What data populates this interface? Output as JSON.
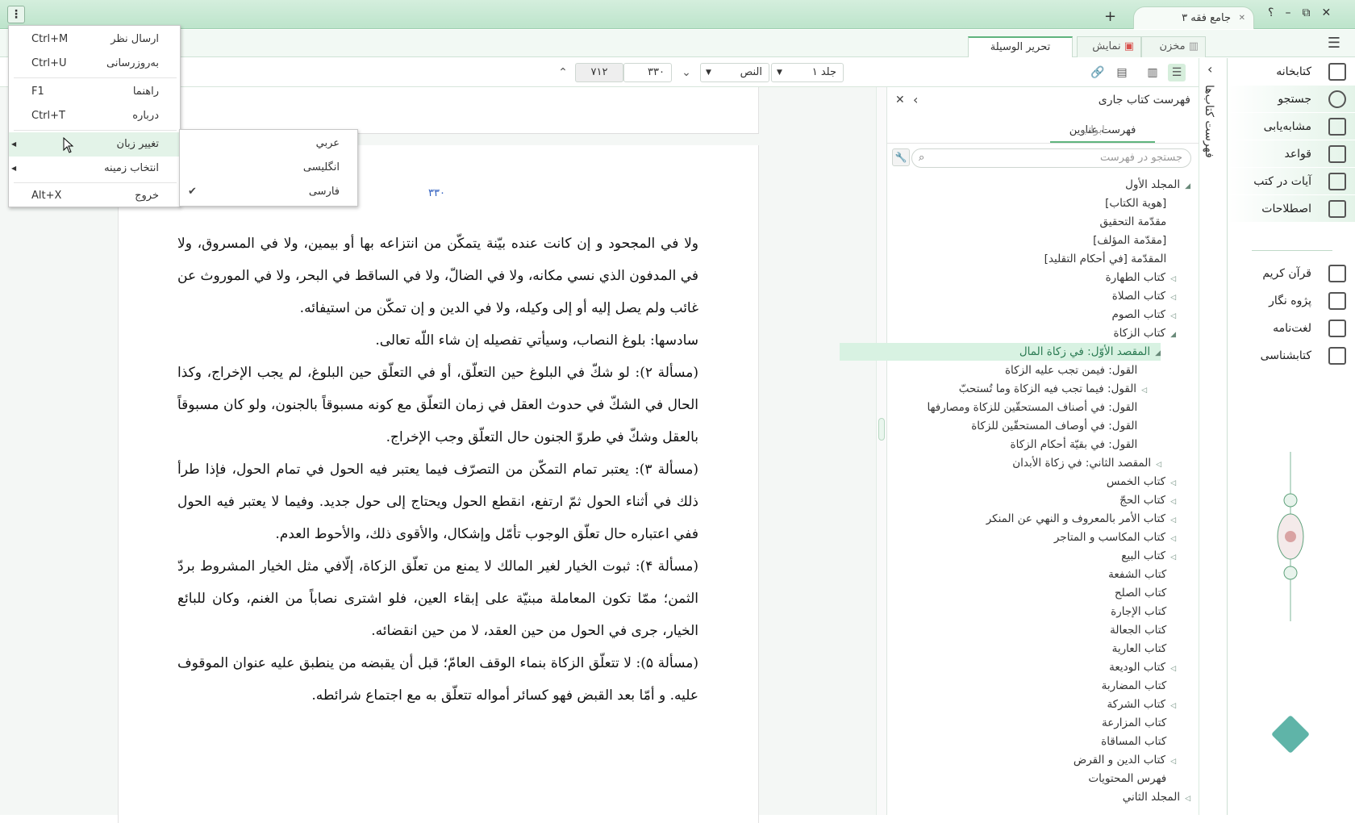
{
  "titlebar": {
    "tab_title": "جامع فقه ۳",
    "add_tab": "+",
    "help": "؟",
    "minimize": "–",
    "restore": "⧉",
    "close": "✕"
  },
  "view_tabs": {
    "storage": "مخزن",
    "display": "نمایش",
    "book_title": "تحرير الوسيلة"
  },
  "toolbar": {
    "volume": "جلد ۱",
    "mode": "النص",
    "page": "۳۳۰",
    "total": "۷۱۲"
  },
  "main_menu": {
    "items": [
      {
        "label": "ارسال نظر",
        "shortcut": "Ctrl+M"
      },
      {
        "label": "به‌روزرسانی",
        "shortcut": "Ctrl+U"
      },
      {
        "label": "راهنما",
        "shortcut": "F1"
      },
      {
        "label": "درباره",
        "shortcut": "Ctrl+T"
      },
      {
        "label": "تغییر زبان",
        "shortcut": ""
      },
      {
        "label": "انتخاب زمینه",
        "shortcut": ""
      },
      {
        "label": "خروج",
        "shortcut": "Alt+X"
      }
    ]
  },
  "language_submenu": {
    "items": [
      "عربي",
      "انگلیسی",
      "فارسی"
    ],
    "selected": "فارسی"
  },
  "right_nav": {
    "primary": [
      "کتابخانه",
      "جستجو",
      "مشابه‌یابی",
      "قواعد",
      "آیات در کتب",
      "اصطلاحات"
    ],
    "secondary": [
      "قرآن کریم",
      "پژوه نگار",
      "لغت‌نامه",
      "کتابشناسی"
    ]
  },
  "side_panel_label": "فهرست کتاب‌ها",
  "toc": {
    "title": "فهرست کتاب جاری",
    "tabs": [
      "فهرست عناوین",
      "ابواب"
    ],
    "search_placeholder": "جستجو در فهرست",
    "items": [
      "المجلد الأول",
      "[هوية الكتاب]",
      "مقدّمة التحقيق",
      "[مقدّمة المؤلف]",
      "المقدّمة [في أحكام التقليد]",
      "كتاب الطهارة",
      "كتاب الصلاة",
      "كتاب الصوم",
      "كتاب الزكاة",
      "المقصد الأوّل: في زكاة المال",
      "القول: فيمن تجب عليه الزكاة",
      "القول: فيما تجب فيه الزكاة وما تُستحبّ",
      "القول: في أصناف المستحقّين للزكاة ومصارفها",
      "القول: في أوصاف المستحقّين للزكاة",
      "القول: في بقيّة أحكام الزكاة",
      "المقصد الثاني: في زكاة الأبدان",
      "كتاب الخمس",
      "كتاب الحجّ",
      "كتاب الأمر بالمعروف و النهي عن المنكر",
      "كتاب المكاسب و المتاجر",
      "كتاب البيع",
      "كتاب الشفعة",
      "كتاب الصلح",
      "كتاب الإجارة",
      "كتاب الجعالة",
      "كتاب العارية",
      "كتاب الوديعة",
      "كتاب المضاربة",
      "كتاب الشركة",
      "كتاب المزارعة",
      "كتاب المساقاة",
      "كتاب الدين و القرض",
      "فهرس المحتويات",
      "المجلد الثاني"
    ]
  },
  "page": {
    "number": "۳۳۰",
    "paragraphs": [
      "ولا في المجحود و إن كانت عنده بيّنة يتمكّن من انتزاعه بها أو بيمين، ولا في المسروق، ولا في المدفون الذي نسي مكانه، ولا في الضالّ، ولا في الساقط في البحر، ولا في الموروث عن غائب ولم يصل إليه أو إلى وكيله، ولا في الدين و إن تمكّن من استيفائه.",
      "سادسها: بلوغ النصاب، وسيأتي تفصيله إن شاء اللّه تعالى.",
      "(مسألة ۲): لو شكّ في البلوغ حين التعلّق، أو في التعلّق حين البلوغ، لم يجب الإخراج، وكذا الحال في الشكّ في حدوث العقل في زمان التعلّق مع كونه مسبوقاً بالجنون، ولو كان مسبوقاً بالعقل وشكّ في طروّ الجنون حال التعلّق وجب الإخراج.",
      "(مسألة ۳): يعتبر تمام التمكّن من التصرّف فيما يعتبر فيه الحول في تمام الحول، فإذا طرأ ذلك في أثناء الحول ثمّ ارتفع، انقطع الحول ويحتاج إلى حول جديد. وفيما لا يعتبر فيه الحول ففي اعتباره حال تعلّق الوجوب تأمّل وإشكال، والأقوى ذلك، والأحوط العدم.",
      "(مسألة ۴): ثبوت الخيار لغير المالك لا يمنع من تعلّق الزكاة، إلّافي مثل الخيار المشروط بردّ الثمن؛ ممّا تكون المعاملة مبنيّة على إبقاء العين، فلو اشترى نصاباً من الغنم، وكان للبائع الخيار، جرى في الحول من حين العقد، لا من حين انقضائه.",
      "(مسألة ۵): لا تتعلّق الزكاة بنماء الوقف العامّ؛ قبل أن يقبضه من ينطبق عليه عنوان الموقوف عليه. و أمّا بعد القبض فهو كسائر أمواله تتعلّق به مع اجتماع شرائطه."
    ]
  }
}
